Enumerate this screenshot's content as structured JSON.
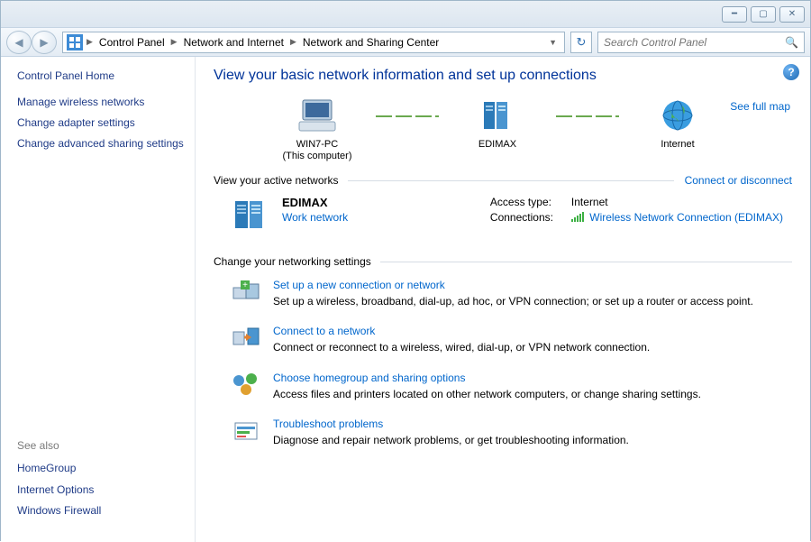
{
  "breadcrumb": [
    "Control Panel",
    "Network and Internet",
    "Network and Sharing Center"
  ],
  "search": {
    "placeholder": "Search Control Panel"
  },
  "sidebar": {
    "home": "Control Panel Home",
    "links": [
      "Manage wireless networks",
      "Change adapter settings",
      "Change advanced sharing settings"
    ],
    "see_also_label": "See also",
    "see_also": [
      "HomeGroup",
      "Internet Options",
      "Windows Firewall"
    ]
  },
  "main": {
    "heading": "View your basic network information and set up connections",
    "see_full_map": "See full map",
    "map": {
      "pc_name": "WIN7-PC",
      "pc_sub": "(This computer)",
      "router": "EDIMAX",
      "internet": "Internet"
    },
    "active_label": "View your active networks",
    "connect_disconnect": "Connect or disconnect",
    "active_net": {
      "name": "EDIMAX",
      "type": "Work network",
      "access_label": "Access type:",
      "access_value": "Internet",
      "conn_label": "Connections:",
      "conn_value": "Wireless Network Connection (EDIMAX)"
    },
    "change_label": "Change your networking settings",
    "settings": [
      {
        "title": "Set up a new connection or network",
        "desc": "Set up a wireless, broadband, dial-up, ad hoc, or VPN connection; or set up a router or access point."
      },
      {
        "title": "Connect to a network",
        "desc": "Connect or reconnect to a wireless, wired, dial-up, or VPN network connection."
      },
      {
        "title": "Choose homegroup and sharing options",
        "desc": "Access files and printers located on other network computers, or change sharing settings."
      },
      {
        "title": "Troubleshoot problems",
        "desc": "Diagnose and repair network problems, or get troubleshooting information."
      }
    ]
  }
}
